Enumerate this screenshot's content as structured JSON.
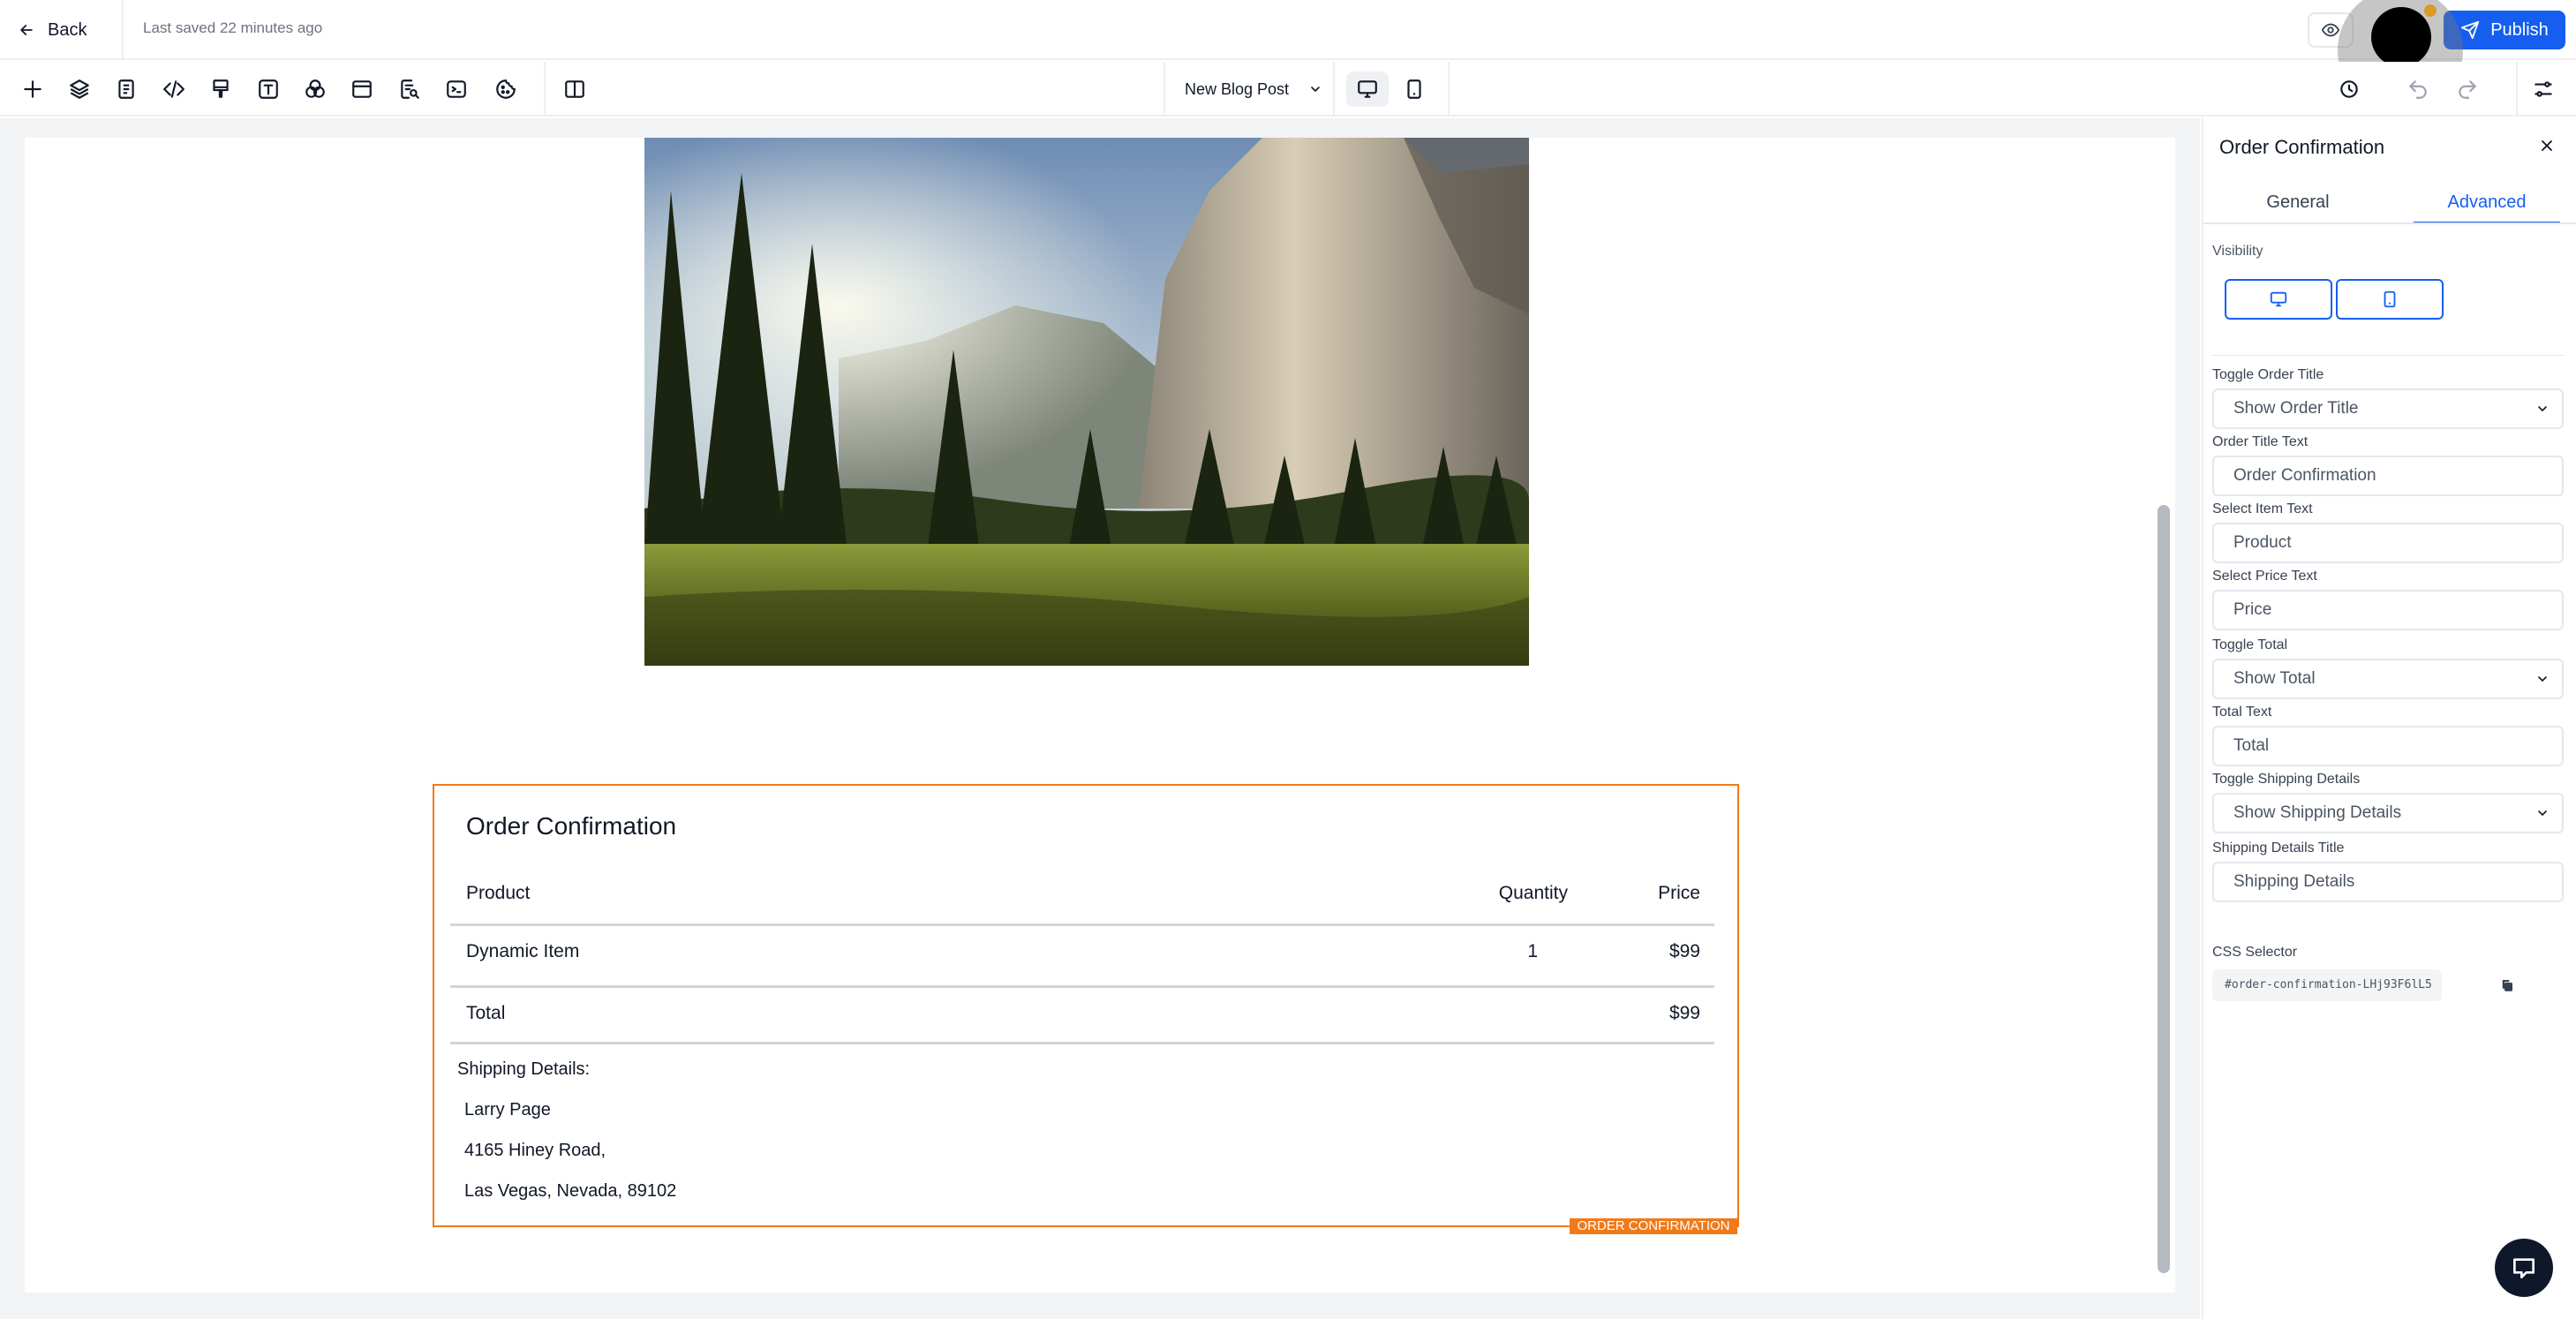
{
  "header": {
    "back_label": "Back",
    "last_saved": "Last saved 22 minutes ago",
    "publish_label": "Publish"
  },
  "toolbar": {
    "tools": [
      "add-icon",
      "layers-icon",
      "pages-icon",
      "code-icon",
      "paint-brush-icon",
      "text-icon",
      "color-palette-icon",
      "section-icon",
      "seo-icon",
      "terminal-icon",
      "cookie-icon",
      "split-view-icon"
    ],
    "page_selector_label": "New Blog Post",
    "device_modes": [
      "desktop",
      "mobile"
    ],
    "active_device": "desktop"
  },
  "order_element": {
    "title": "Order Confirmation",
    "headers": {
      "product": "Product",
      "quantity": "Quantity",
      "price": "Price"
    },
    "item": {
      "name": "Dynamic Item",
      "quantity": "1",
      "price": "$99"
    },
    "total": {
      "label": "Total",
      "price": "$99"
    },
    "shipping": {
      "label": "Shipping Details:",
      "name": "Larry Page",
      "street": "4165 Hiney Road,",
      "city": "Las Vegas, Nevada, 89102"
    },
    "tag": "ORDER CONFIRMATION"
  },
  "panel": {
    "title": "Order Confirmation",
    "tabs": {
      "general": "General",
      "advanced": "Advanced"
    },
    "active_tab": "Advanced",
    "visibility_label": "Visibility",
    "fields": [
      {
        "label": "Toggle Order Title",
        "value": "Show Order Title",
        "type": "select"
      },
      {
        "label": "Order Title Text",
        "value": "Order Confirmation",
        "type": "text"
      },
      {
        "label": "Select Item Text",
        "value": "Product",
        "type": "text"
      },
      {
        "label": "Select Price Text",
        "value": "Price",
        "type": "text"
      },
      {
        "label": "Toggle Total",
        "value": "Show Total",
        "type": "select"
      },
      {
        "label": "Total Text",
        "value": "Total",
        "type": "text"
      },
      {
        "label": "Toggle Shipping Details",
        "value": "Show Shipping Details",
        "type": "select"
      },
      {
        "label": "Shipping Details Title",
        "value": "Shipping Details",
        "type": "text"
      }
    ],
    "css_selector_label": "CSS Selector",
    "css_selector_value": "#order-confirmation-LHj93F6lL5"
  },
  "colors": {
    "accent": "#155eef",
    "selection": "#f07a1a",
    "chat_button": "#0f172a"
  }
}
